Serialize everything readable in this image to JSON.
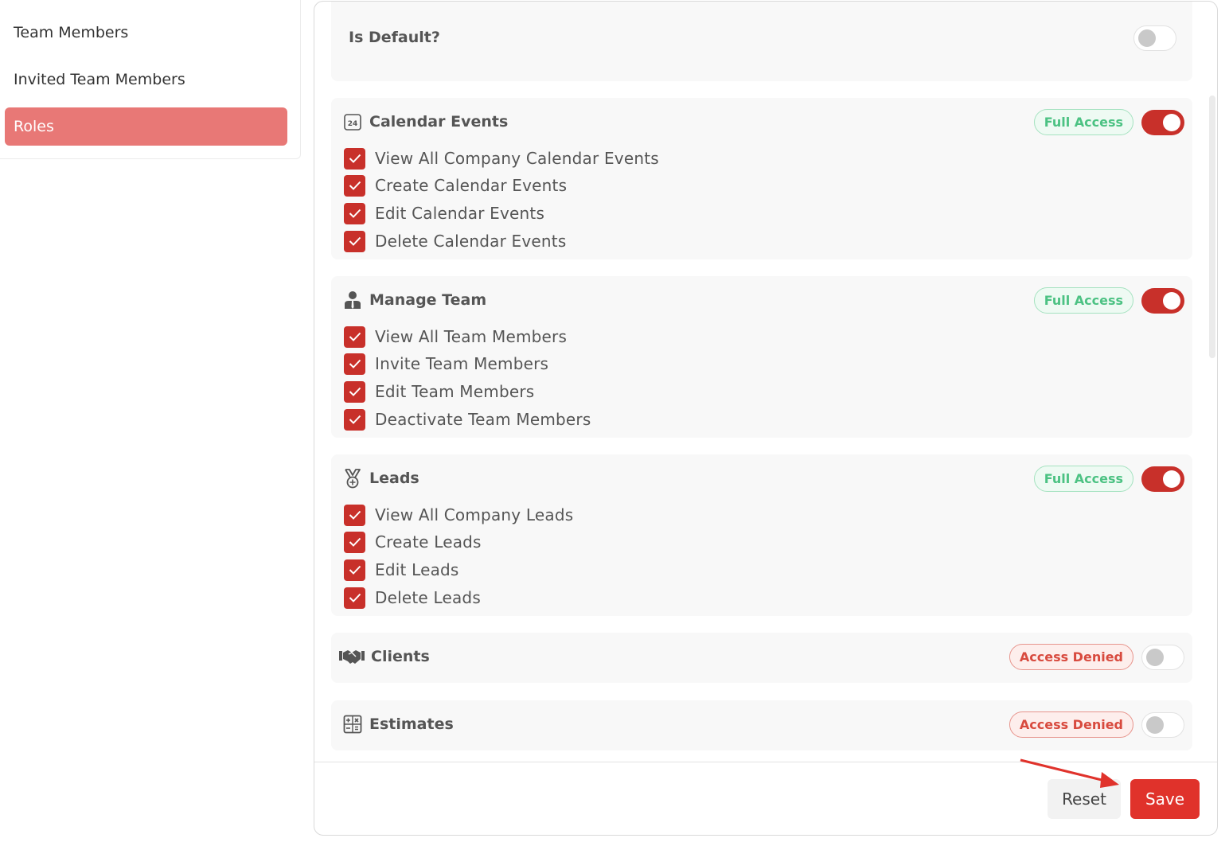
{
  "sidebar": {
    "items": [
      {
        "label": "Team Members"
      },
      {
        "label": "Invited Team Members"
      },
      {
        "label": "Roles"
      }
    ]
  },
  "default_setting": {
    "label": "Is Default?",
    "enabled": false
  },
  "sections": [
    {
      "title": "Calendar Events",
      "icon": "calendar-24-icon",
      "badge": "Full Access",
      "enabled": true,
      "permissions": [
        "View All Company Calendar Events",
        "Create Calendar Events",
        "Edit Calendar Events",
        "Delete Calendar Events"
      ]
    },
    {
      "title": "Manage Team",
      "icon": "person-tie-icon",
      "badge": "Full Access",
      "enabled": true,
      "permissions": [
        "View All Team Members",
        "Invite Team Members",
        "Edit Team Members",
        "Deactivate Team Members"
      ]
    },
    {
      "title": "Leads",
      "icon": "medal-icon",
      "badge": "Full Access",
      "enabled": true,
      "permissions": [
        "View All Company Leads",
        "Create Leads",
        "Edit Leads",
        "Delete Leads"
      ]
    },
    {
      "title": "Clients",
      "icon": "handshake-icon",
      "badge": "Access Denied",
      "enabled": false,
      "permissions": []
    },
    {
      "title": "Estimates",
      "icon": "calculator-icon",
      "badge": "Access Denied",
      "enabled": false,
      "permissions": []
    }
  ],
  "footer": {
    "reset_label": "Reset",
    "save_label": "Save"
  },
  "colors": {
    "accent": "#c8302a",
    "sidebar_active": "#e87876",
    "full_access": "#4cc283",
    "denied": "#d84a3e",
    "save": "#e0322b"
  }
}
